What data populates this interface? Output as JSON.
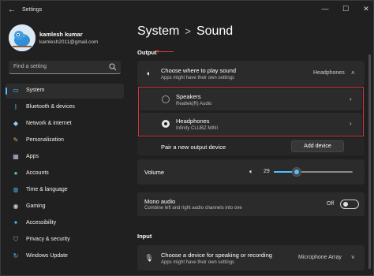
{
  "window": {
    "title": "Settings",
    "back_icon": "back-arrow-icon",
    "minimize_icon": "minimize-icon",
    "maximize_icon": "maximize-icon",
    "close_icon": "close-icon"
  },
  "profile": {
    "name": "kamlesh kumar",
    "email": "kamlesh2011@gmail.com"
  },
  "search": {
    "placeholder": "Find a setting"
  },
  "sidebar": {
    "items": [
      {
        "label": "System",
        "icon": "monitor-icon",
        "active": true
      },
      {
        "label": "Bluetooth & devices",
        "icon": "bluetooth-icon"
      },
      {
        "label": "Network & internet",
        "icon": "wifi-icon"
      },
      {
        "label": "Personalization",
        "icon": "brush-icon"
      },
      {
        "label": "Apps",
        "icon": "apps-icon"
      },
      {
        "label": "Accounts",
        "icon": "person-icon"
      },
      {
        "label": "Time & language",
        "icon": "globe-clock-icon"
      },
      {
        "label": "Gaming",
        "icon": "controller-icon"
      },
      {
        "label": "Accessibility",
        "icon": "accessibility-icon"
      },
      {
        "label": "Privacy & security",
        "icon": "shield-icon"
      },
      {
        "label": "Windows Update",
        "icon": "update-icon"
      }
    ]
  },
  "breadcrumb": {
    "parent": "System",
    "separator": ">",
    "current": "Sound"
  },
  "output": {
    "section_label": "Output",
    "choose": {
      "title": "Choose where to play sound",
      "subtitle": "Apps might have their own settings",
      "value": "Headphones"
    },
    "devices": [
      {
        "name": "Speakers",
        "detail": "Realtek(R) Audio",
        "selected": false
      },
      {
        "name": "Headphones",
        "detail": "Infinity CLUBZ MINI",
        "selected": true
      }
    ],
    "pair": {
      "label": "Pair a new output device",
      "button": "Add device"
    },
    "volume": {
      "label": "Volume",
      "value": "29",
      "level": 0.29
    },
    "mono": {
      "title": "Mono audio",
      "subtitle": "Combine left and right audio channels into one",
      "state": "Off"
    }
  },
  "input": {
    "section_label": "Input",
    "choose": {
      "title": "Choose a device for speaking or recording",
      "subtitle": "Apps might have their own settings",
      "value": "Microphone Array"
    }
  },
  "colors": {
    "accent": "#4cc2ff",
    "highlight": "#d0393c",
    "background": "#202020",
    "card": "#2b2b2b"
  }
}
